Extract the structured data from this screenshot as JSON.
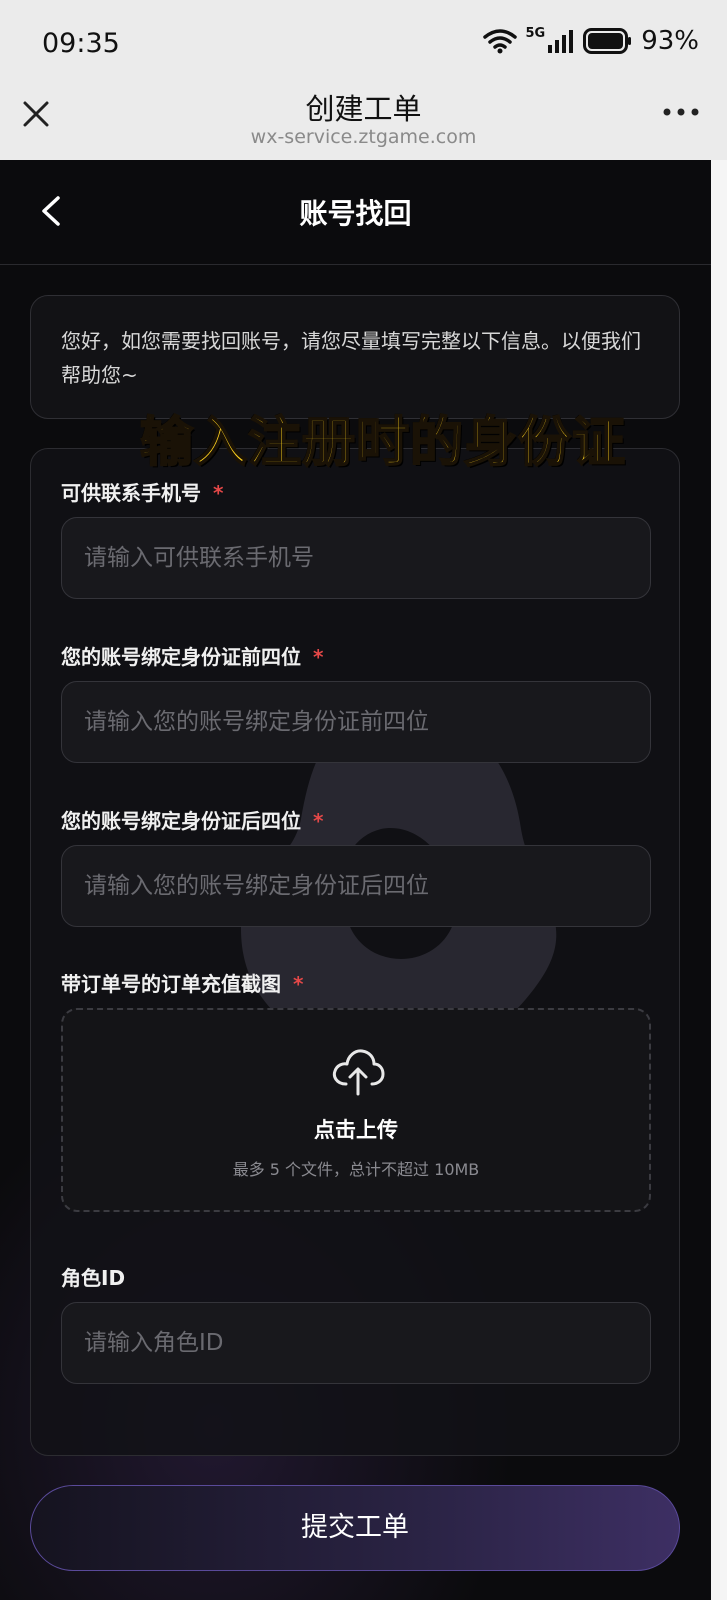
{
  "status_bar": {
    "time": "09:35",
    "network": "5G",
    "battery": "93%"
  },
  "miniapp": {
    "title": "创建工单",
    "domain": "wx-service.ztgame.com"
  },
  "page": {
    "title": "账号找回"
  },
  "notice": "您好，如您需要找回账号，请您尽量填写完整以下信息。以便我们帮助您~",
  "overlay_caption": "输入注册时的身份证",
  "form": {
    "fields": [
      {
        "label": "可供联系手机号",
        "required_mark": "*",
        "placeholder": "请输入可供联系手机号",
        "value": ""
      },
      {
        "label": "您的账号绑定身份证前四位",
        "required_mark": "*",
        "placeholder": "请输入您的账号绑定身份证前四位",
        "value": ""
      },
      {
        "label": "您的账号绑定身份证后四位",
        "required_mark": "*",
        "placeholder": "请输入您的账号绑定身份证后四位",
        "value": ""
      },
      {
        "label": "角色ID",
        "required_mark": "",
        "placeholder": "请输入角色ID",
        "value": ""
      }
    ],
    "upload": {
      "label": "带订单号的订单充值截图",
      "required_mark": "*",
      "title": "点击上传",
      "hint": "最多 5 个文件，总计不超过 10MB",
      "icon": "cloud-upload-icon"
    }
  },
  "submit_label": "提交工单",
  "colors": {
    "required": "#e54848",
    "overlay_text": "#ffd21f",
    "submit_border": "#5a4a9a"
  }
}
